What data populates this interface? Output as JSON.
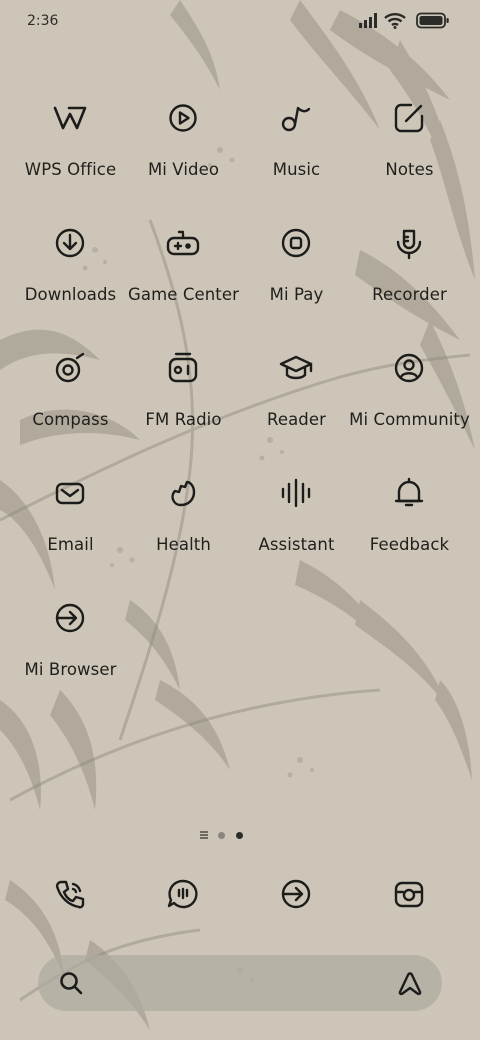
{
  "status_bar": {
    "time": "2:36",
    "icons": [
      "signal-icon",
      "wifi-icon",
      "battery-icon"
    ]
  },
  "apps": [
    {
      "label": "WPS Office",
      "icon": "wps-office-icon"
    },
    {
      "label": "Mi Video",
      "icon": "mi-video-icon"
    },
    {
      "label": "Music",
      "icon": "music-icon"
    },
    {
      "label": "Notes",
      "icon": "notes-icon"
    },
    {
      "label": "Downloads",
      "icon": "downloads-icon"
    },
    {
      "label": "Game Center",
      "icon": "game-center-icon"
    },
    {
      "label": "Mi Pay",
      "icon": "mi-pay-icon"
    },
    {
      "label": "Recorder",
      "icon": "recorder-icon"
    },
    {
      "label": "Compass",
      "icon": "compass-icon"
    },
    {
      "label": "FM Radio",
      "icon": "fm-radio-icon"
    },
    {
      "label": "Reader",
      "icon": "reader-icon"
    },
    {
      "label": "Mi Community",
      "icon": "mi-community-icon"
    },
    {
      "label": "Email",
      "icon": "email-icon"
    },
    {
      "label": "Health",
      "icon": "health-icon"
    },
    {
      "label": "Assistant",
      "icon": "assistant-icon"
    },
    {
      "label": "Feedback",
      "icon": "feedback-icon"
    },
    {
      "label": "Mi Browser",
      "icon": "mi-browser-icon"
    }
  ],
  "page_indicator": {
    "pages": 3,
    "current": 2
  },
  "dock": [
    "phone-icon",
    "messages-icon",
    "browser-icon",
    "camera-icon"
  ],
  "search_bar": {
    "left_icon": "search-icon",
    "right_icon": "assistant-a-icon"
  },
  "colors": {
    "background": "#cdc6b8",
    "icon_stroke": "#1c1c1a",
    "foliage": "#8e887c"
  }
}
